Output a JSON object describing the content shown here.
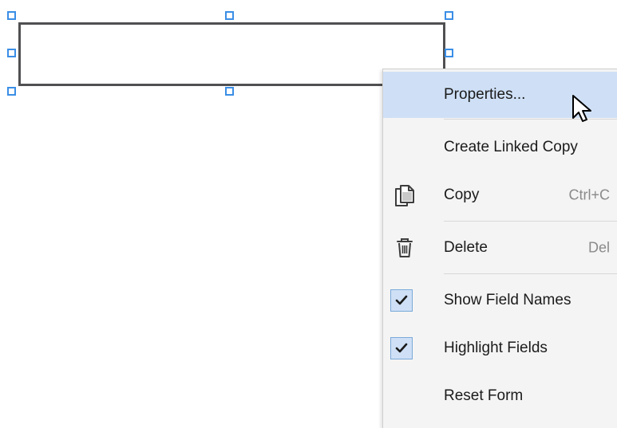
{
  "menu": {
    "items": [
      {
        "label": "Properties...",
        "shortcut": ""
      },
      {
        "label": "Create Linked Copy",
        "shortcut": ""
      },
      {
        "label": "Copy",
        "shortcut": "Ctrl+C"
      },
      {
        "label": "Delete",
        "shortcut": "Del"
      },
      {
        "label": "Show Field Names",
        "shortcut": ""
      },
      {
        "label": "Highlight Fields",
        "shortcut": ""
      },
      {
        "label": "Reset Form",
        "shortcut": ""
      }
    ],
    "icons": {
      "copy": "copy-icon",
      "delete": "trash-icon",
      "show_field_names": "checkmark-icon",
      "highlight_fields": "checkmark-icon"
    },
    "checked": {
      "show_field_names": true,
      "highlight_fields": true
    },
    "highlighted_item": "Properties..."
  },
  "colors": {
    "handle": "#3a8ee6",
    "highlight": "#cfe0f6",
    "field_border": "#505052",
    "menu_bg": "#f4f4f4"
  }
}
